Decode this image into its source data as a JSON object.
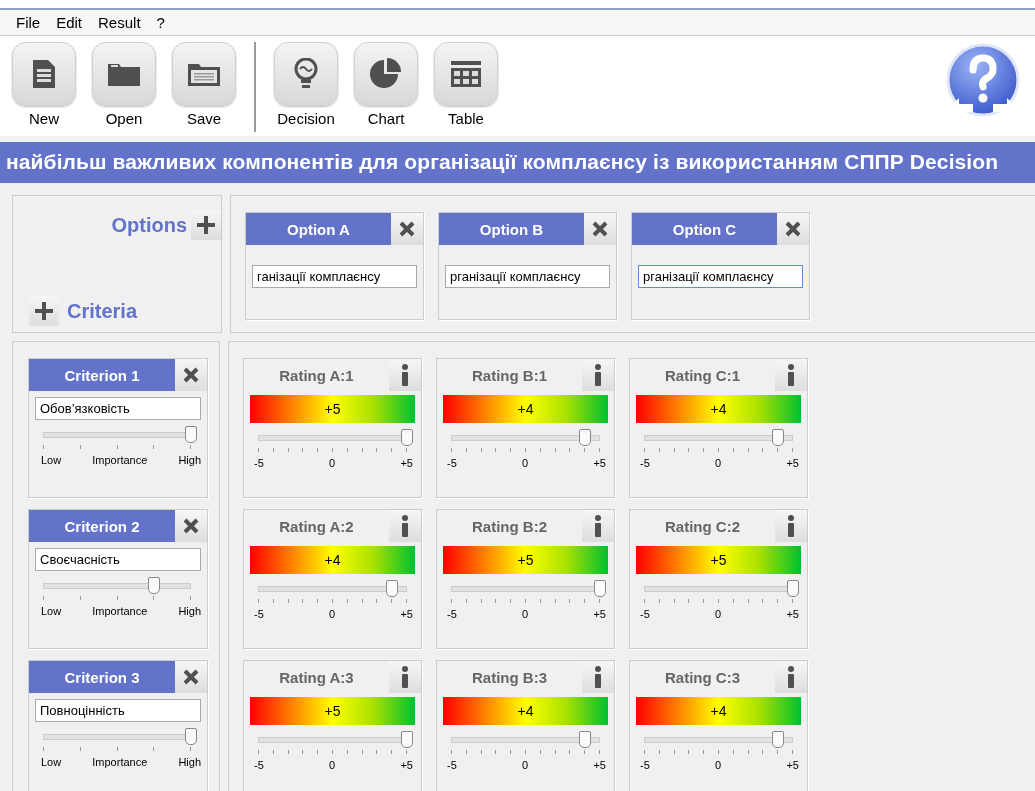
{
  "menu": [
    "File",
    "Edit",
    "Result",
    "?"
  ],
  "toolbar": {
    "groups": [
      [
        {
          "kind": "new",
          "label": "New"
        },
        {
          "kind": "open",
          "label": "Open"
        },
        {
          "kind": "save",
          "label": "Save"
        }
      ],
      [
        {
          "kind": "decision",
          "label": "Decision"
        },
        {
          "kind": "chart",
          "label": "Chart"
        },
        {
          "kind": "table",
          "label": "Table"
        }
      ]
    ]
  },
  "title": "найбільш важливих компонентів для організації комплаєнсу із використанням СППР Decision",
  "options_label": "Options",
  "criteria_label": "Criteria",
  "options": [
    {
      "title": "Option A",
      "value": "ганізації комплаєнсу",
      "focused": false
    },
    {
      "title": "Option B",
      "value": "рганізації комплаєнсу",
      "focused": false
    },
    {
      "title": "Option C",
      "value": "рганізації комплаєнсу",
      "focused": true
    }
  ],
  "criteria": [
    {
      "title": "Criterion 1",
      "name": "Обов’язковість",
      "importance": {
        "level": 1,
        "scale": [
          "Low",
          "Importance",
          "High"
        ]
      },
      "ratings": [
        {
          "label": "Rating A:1",
          "value": "+5",
          "level": 1,
          "scale": [
            "-5",
            "0",
            "+5"
          ]
        },
        {
          "label": "Rating B:1",
          "value": "+4",
          "level": 0.9,
          "scale": [
            "-5",
            "0",
            "+5"
          ]
        },
        {
          "label": "Rating C:1",
          "value": "+4",
          "level": 0.9,
          "scale": [
            "-5",
            "0",
            "+5"
          ]
        }
      ]
    },
    {
      "title": "Criterion 2",
      "name": "Своєчасність",
      "importance": {
        "level": 0.75,
        "scale": [
          "Low",
          "Importance",
          "High"
        ]
      },
      "ratings": [
        {
          "label": "Rating A:2",
          "value": "+4",
          "level": 0.9,
          "scale": [
            "-5",
            "0",
            "+5"
          ]
        },
        {
          "label": "Rating B:2",
          "value": "+5",
          "level": 1,
          "scale": [
            "-5",
            "0",
            "+5"
          ]
        },
        {
          "label": "Rating C:2",
          "value": "+5",
          "level": 1,
          "scale": [
            "-5",
            "0",
            "+5"
          ]
        }
      ]
    },
    {
      "title": "Criterion 3",
      "name": "Повноцінність",
      "importance": {
        "level": 1,
        "scale": [
          "Low",
          "Importance",
          "High"
        ]
      },
      "ratings": [
        {
          "label": "Rating A:3",
          "value": "+5",
          "level": 1,
          "scale": [
            "-5",
            "0",
            "+5"
          ]
        },
        {
          "label": "Rating B:3",
          "value": "+4",
          "level": 0.9,
          "scale": [
            "-5",
            "0",
            "+5"
          ]
        },
        {
          "label": "Rating C:3",
          "value": "+4",
          "level": 0.9,
          "scale": [
            "-5",
            "0",
            "+5"
          ]
        }
      ]
    }
  ]
}
